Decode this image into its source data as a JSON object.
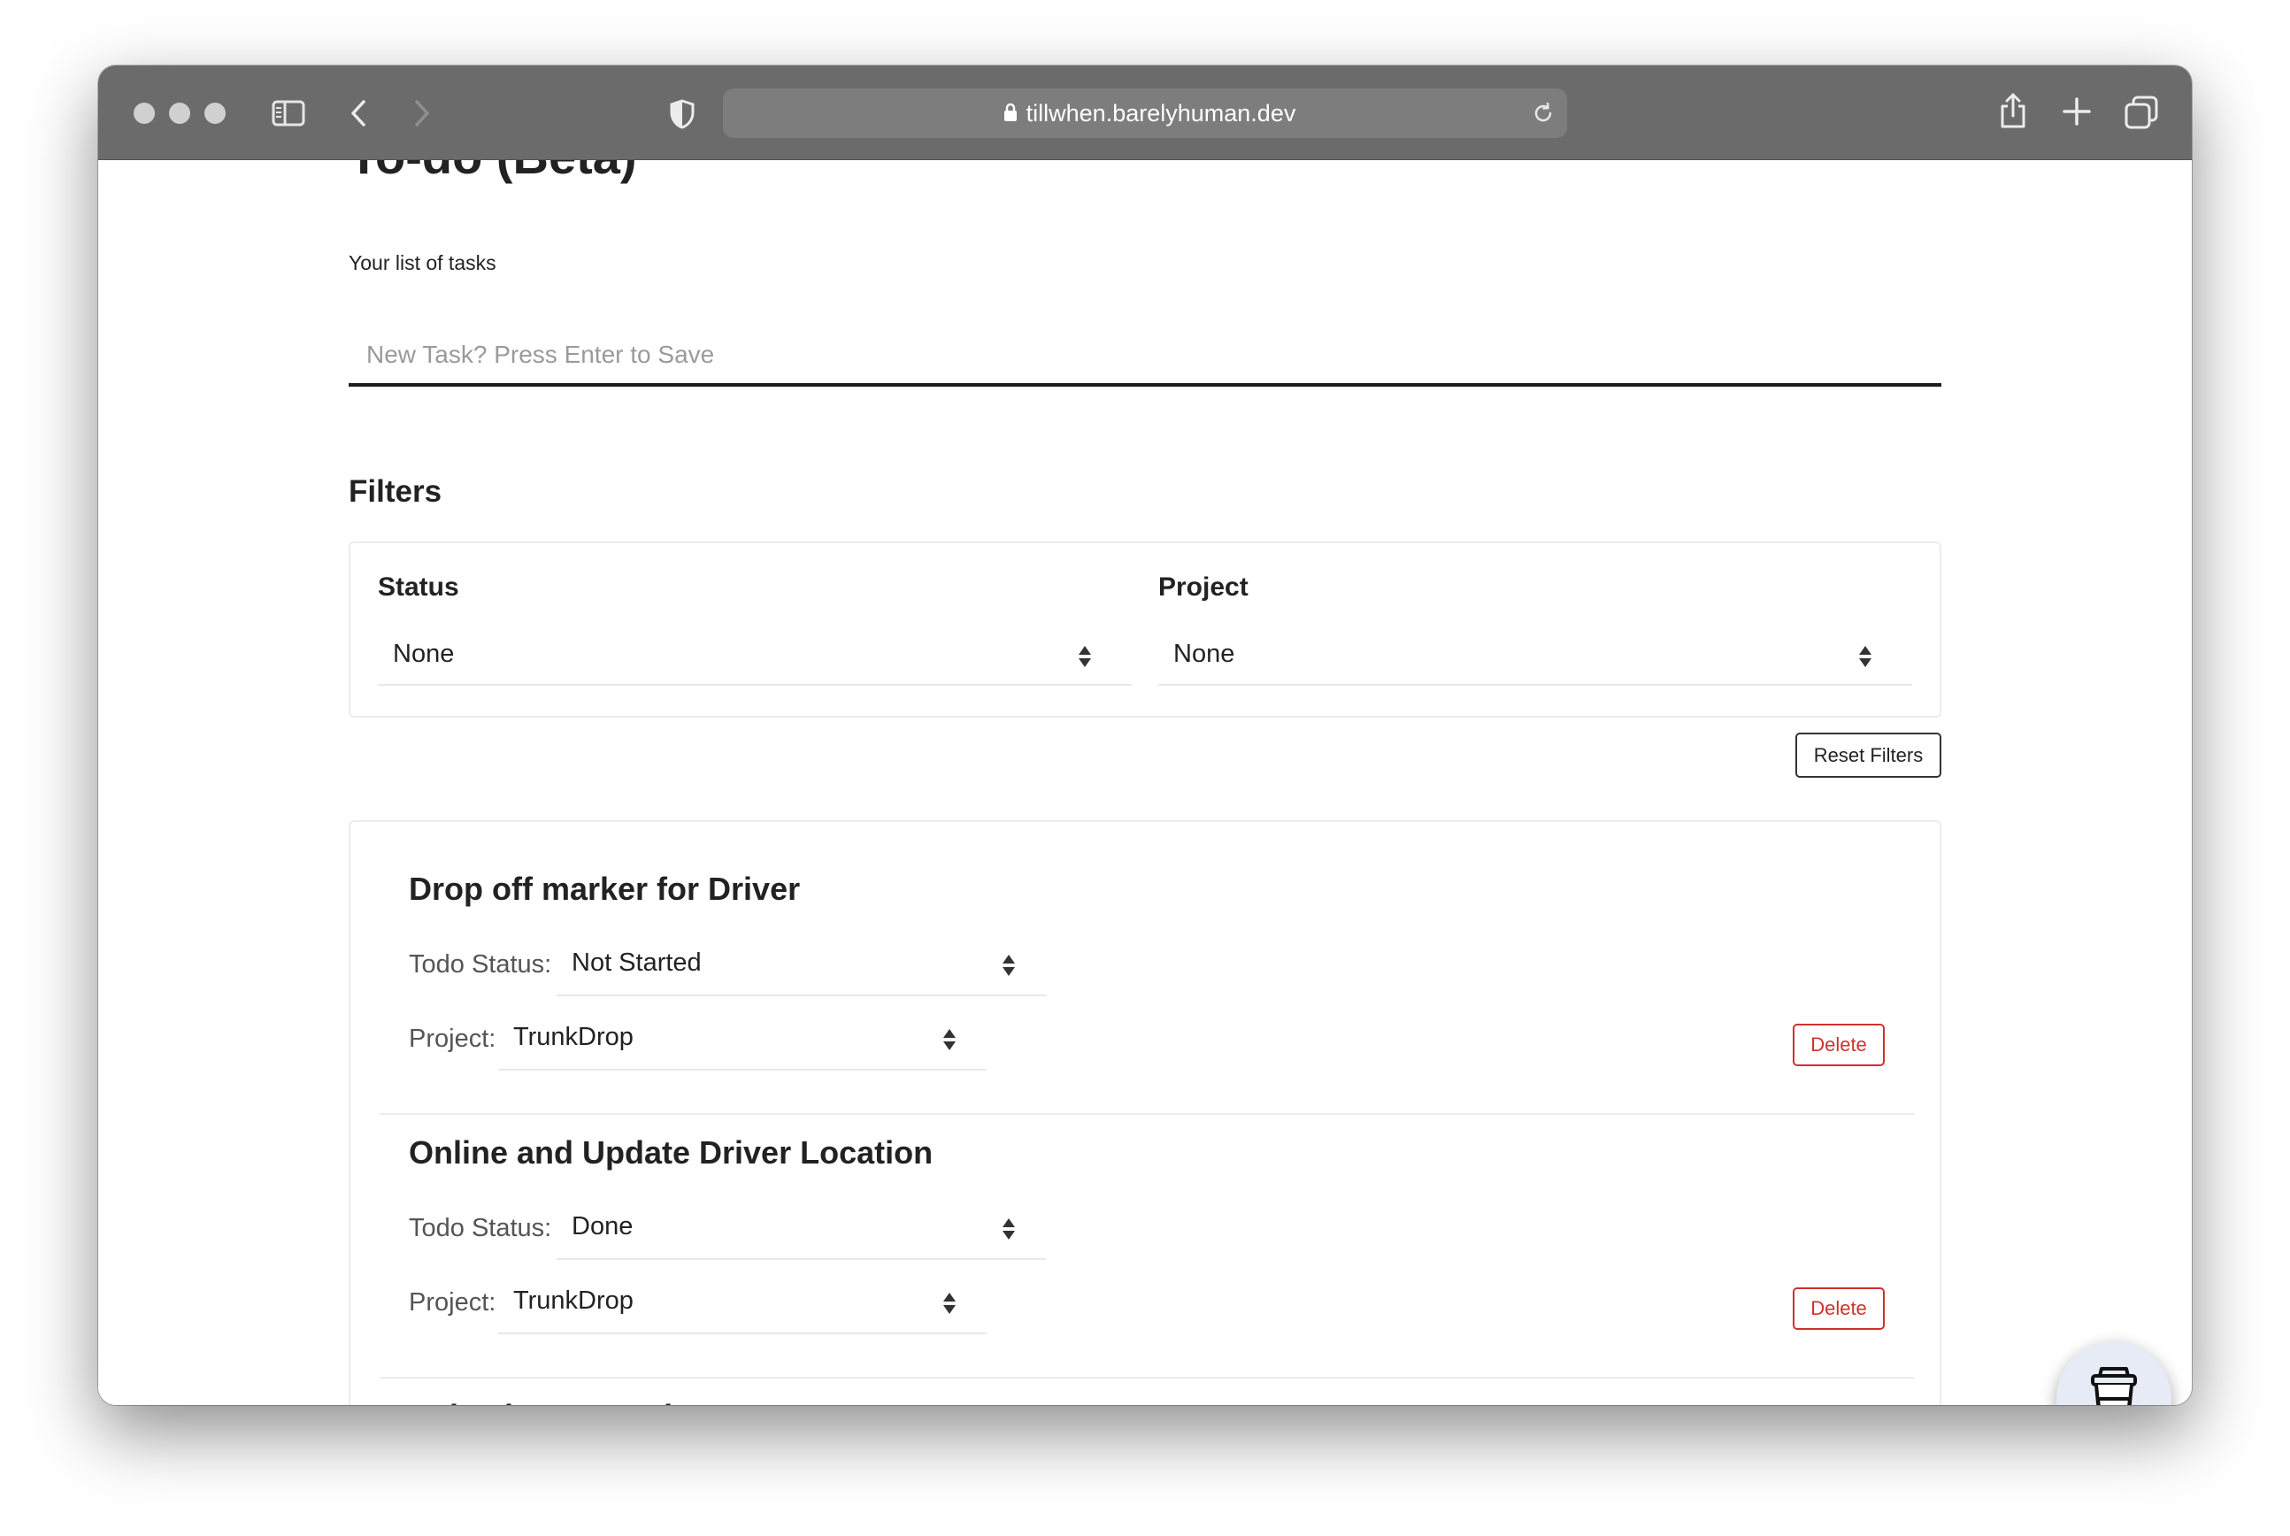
{
  "browser": {
    "url": "tillwhen.barelyhuman.dev",
    "icons": [
      "sidebar-icon",
      "back-icon",
      "forward-icon",
      "shield-icon",
      "lock-icon",
      "reload-icon",
      "share-icon",
      "new-tab-icon",
      "tabs-overview-icon"
    ]
  },
  "page": {
    "title": "To-do (Beta)",
    "subtitle": "Your list of tasks"
  },
  "new_task": {
    "placeholder": "New Task? Press Enter to Save",
    "value": ""
  },
  "filters": {
    "heading": "Filters",
    "status": {
      "label": "Status",
      "selected": "None"
    },
    "project": {
      "label": "Project",
      "selected": "None"
    },
    "reset_label": "Reset Filters"
  },
  "tasks": [
    {
      "title": "Drop off marker for Driver",
      "status_label": "Todo Status:",
      "status": "Not Started",
      "project_label": "Project:",
      "project": "TrunkDrop",
      "delete_label": "Delete"
    },
    {
      "title": "Online and Update Driver Location",
      "status_label": "Todo Status:",
      "status": "Done",
      "project_label": "Project:",
      "project": "TrunkDrop",
      "delete_label": "Delete"
    },
    {
      "title": "Poly Line Examples"
    }
  ],
  "colors": {
    "toolbar": "#6b6b6b",
    "delete": "#d0312d",
    "input_underline": "#1c1c1c"
  },
  "floating_button": {
    "icon": "coffee-cup-icon"
  }
}
